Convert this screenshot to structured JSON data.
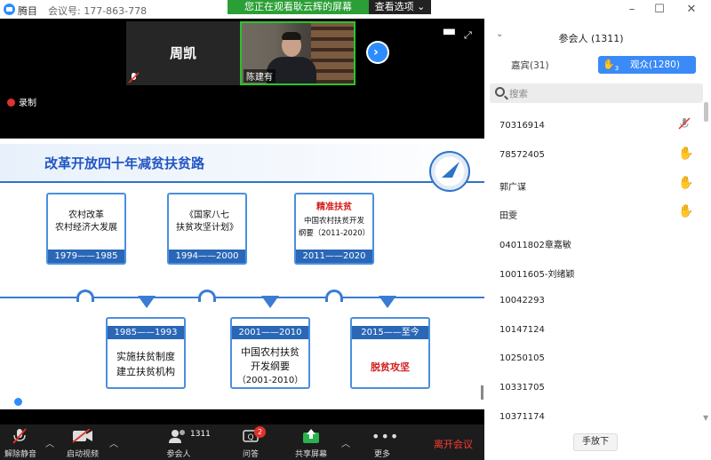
{
  "titlebar": {
    "app_title": "腾目",
    "meeting_id": "会议号: 177-863-778",
    "minimize": "–",
    "maximize": "☐",
    "close": "✕"
  },
  "banner": {
    "text": "您正在观看耿云辉的屏幕",
    "view_options": "查看选项 ⌄"
  },
  "video": {
    "tile1_name": "周凯",
    "tile2_name": "陈建有",
    "record_label": "录制"
  },
  "slide": {
    "title": "改革开放四十年减贫扶贫路",
    "top_boxes": [
      {
        "lines": [
          "农村改革",
          "农村经济大发展"
        ],
        "years": "1979——1985"
      },
      {
        "lines": [
          "《国家八七",
          "扶贫攻坚计划》"
        ],
        "years": "1994——2000"
      },
      {
        "lines": [
          "精准扶贫",
          "中国农村扶贫开发",
          "纲要（2011-2020）"
        ],
        "years": "2011——2020"
      }
    ],
    "bottom_boxes": [
      {
        "years": "1985——1993",
        "lines": [
          "实施扶贫制度",
          "建立扶贫机构"
        ]
      },
      {
        "years": "2001——2010",
        "lines": [
          "中国农村扶贫",
          "开发纲要",
          "（2001-2010）"
        ]
      },
      {
        "years": "2015——至今",
        "lines": [
          "脱贫攻坚"
        ]
      }
    ]
  },
  "toolbar": {
    "unmute": "解除静音",
    "start_video": "启动视频",
    "participants": "参会人",
    "participants_count": "1311",
    "qa": "问答",
    "qa_badge": "2",
    "share": "共享屏幕",
    "more": "更多",
    "leave": "离开会议"
  },
  "sidebar": {
    "title": "参会人 (1311)",
    "tab_guests": "嘉宾(31)",
    "tab_audience": "观众(1280)",
    "hand_count": "3",
    "search_placeholder": "搜索",
    "participants": [
      {
        "name": "70316914",
        "status": "muted"
      },
      {
        "name": "78572405",
        "status": "hand"
      },
      {
        "name": "郭广谋",
        "status": "hand"
      },
      {
        "name": "田雯",
        "status": "hand"
      },
      {
        "name": "04011802章嘉敏",
        "status": ""
      },
      {
        "name": "10011605-刘绪颖",
        "status": ""
      },
      {
        "name": "10042293",
        "status": ""
      },
      {
        "name": "10147124",
        "status": ""
      },
      {
        "name": "10250105",
        "status": ""
      },
      {
        "name": "10331705",
        "status": ""
      },
      {
        "name": "10371174",
        "status": ""
      }
    ],
    "lower_hands": "手放下"
  },
  "colors": {
    "accent": "#2d8cff",
    "banner_green": "#2a9f35",
    "slide_blue": "#2a67b7",
    "leave_red": "#ff3b30"
  }
}
